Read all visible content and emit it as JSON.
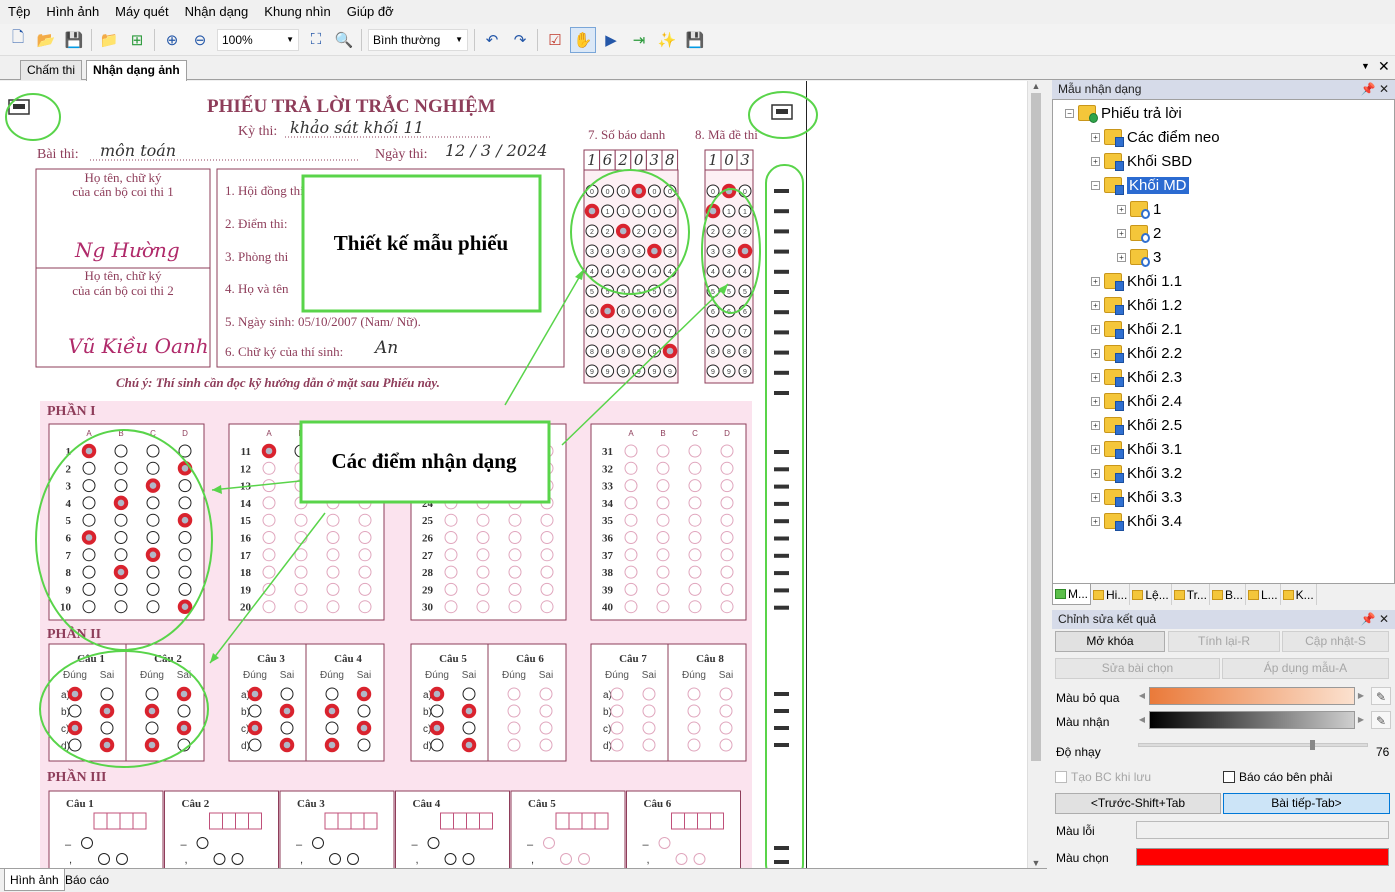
{
  "menu": [
    "Tệp",
    "Hình ảnh",
    "Máy quét",
    "Nhận dạng",
    "Khung nhìn",
    "Giúp đỡ"
  ],
  "toolbar": {
    "zoom": "100%",
    "mode": "Bình thường"
  },
  "doc_tabs": [
    "Chấm thi",
    "Nhận dạng ảnh"
  ],
  "bottom_tabs": [
    "Hình ảnh",
    "Báo cáo"
  ],
  "sheet": {
    "title": "PHIẾU TRẢ LỜI TRẮC NGHIỆM",
    "ky_thi_label": "Kỳ thi:",
    "ky_thi_value": "khảo sát khối 11",
    "bai_thi_label": "Bài thi:",
    "bai_thi_value": "môn toán",
    "ngay_thi_label": "Ngày thi:",
    "ngay_thi_value": "12 / 3 / 2024",
    "sbd_label": "7. Số báo danh",
    "sbd_digits": [
      "1",
      "6",
      "2",
      "0",
      "3",
      "8"
    ],
    "ma_de_label": "8. Mã đề thi",
    "ma_de_digits": [
      "1",
      "0",
      "3"
    ],
    "sig_label_1": "Họ tên, chữ ký\ncủa cán bộ coi thi 1",
    "sig_label_2": "Họ tên, chữ ký\ncủa cán bộ coi thi 2",
    "sig_1": "Ng Hường",
    "sig_2": "Vũ Kiều Oanh",
    "fields": [
      "1. Hội đồng thi:",
      "2. Điểm thi:",
      "3. Phòng thi",
      "4. Họ và tên",
      "5. Ngày sinh: 05/10/2007 (Nam/ Nữ).",
      "6. Chữ ký của thí sinh:"
    ],
    "student_sign": "An",
    "note": "Chú ý: Thí sinh cần đọc kỹ hướng dẫn ở mặt sau Phiếu này.",
    "part1": "PHẦN I",
    "part2": "PHẦN II",
    "part3": "PHẦN III",
    "choices": [
      "A",
      "B",
      "C",
      "D"
    ],
    "tf_headers": [
      "Đúng",
      "Sai"
    ],
    "tf_rows": [
      "a)",
      "b)",
      "c)",
      "d)"
    ],
    "part2_questions": [
      "Câu 1",
      "Câu 2",
      "Câu 3",
      "Câu 4",
      "Câu 5",
      "Câu 6",
      "Câu 7",
      "Câu 8"
    ],
    "part3_questions": [
      "Câu 1",
      "Câu 2",
      "Câu 3",
      "Câu 4",
      "Câu 5",
      "Câu 6"
    ],
    "part1_answers": {
      "1": 0,
      "2": 3,
      "3": 2,
      "4": 1,
      "5": 3,
      "6": 0,
      "7": 2,
      "8": 1,
      "9": -1,
      "10": 3,
      "11": 0
    },
    "sbd_marks": [
      1,
      6,
      2,
      0,
      3,
      8
    ],
    "made_marks": [
      1,
      0,
      3
    ]
  },
  "callouts": {
    "design": "Thiết kế mẫu phiếu",
    "points": "Các điểm nhận dạng"
  },
  "template_panel": {
    "title": "Mẫu nhận dạng",
    "root": "Phiếu trả lời",
    "nodes": [
      {
        "label": "Các điểm neo",
        "level": 1,
        "expanded": false
      },
      {
        "label": "Khối SBD",
        "level": 1,
        "expanded": false
      },
      {
        "label": "Khối MD",
        "level": 1,
        "expanded": true,
        "selected": true
      },
      {
        "label": "1",
        "level": 2,
        "expanded": false
      },
      {
        "label": "2",
        "level": 2,
        "expanded": false
      },
      {
        "label": "3",
        "level": 2,
        "expanded": false
      },
      {
        "label": "Khối 1.1",
        "level": 1
      },
      {
        "label": "Khối 1.2",
        "level": 1
      },
      {
        "label": "Khối 2.1",
        "level": 1
      },
      {
        "label": "Khối 2.2",
        "level": 1
      },
      {
        "label": "Khối 2.3",
        "level": 1
      },
      {
        "label": "Khối 2.4",
        "level": 1
      },
      {
        "label": "Khối 2.5",
        "level": 1
      },
      {
        "label": "Khối 3.1",
        "level": 1
      },
      {
        "label": "Khối 3.2",
        "level": 1
      },
      {
        "label": "Khối 3.3",
        "level": 1
      },
      {
        "label": "Khối 3.4",
        "level": 1
      }
    ],
    "tabs": [
      "M...",
      "Hi...",
      "Lệ...",
      "Tr...",
      "B...",
      "L...",
      "K..."
    ]
  },
  "edit_panel": {
    "title": "Chỉnh sửa kết quả",
    "unlock": "Mở khóa",
    "recompute": "Tính lại-R",
    "update": "Cập nhật-S",
    "edit_selected": "Sửa bài chọn",
    "apply_template": "Áp dụng mẫu-A",
    "skip_color": "Màu bỏ qua",
    "recognize_color": "Màu nhận",
    "sensitivity": "Độ nhạy",
    "sensitivity_value": "76",
    "sensitivity_level": 0.76,
    "create_report": "Tạo BC khi lưu",
    "report_right": "Báo cáo bên phải",
    "prev": "<Trước-Shift+Tab",
    "next": "Bài tiếp-Tab>",
    "error_color": "Màu lỗi",
    "selected_color": "Màu chọn",
    "selected_color_hex": "#ff0000"
  }
}
